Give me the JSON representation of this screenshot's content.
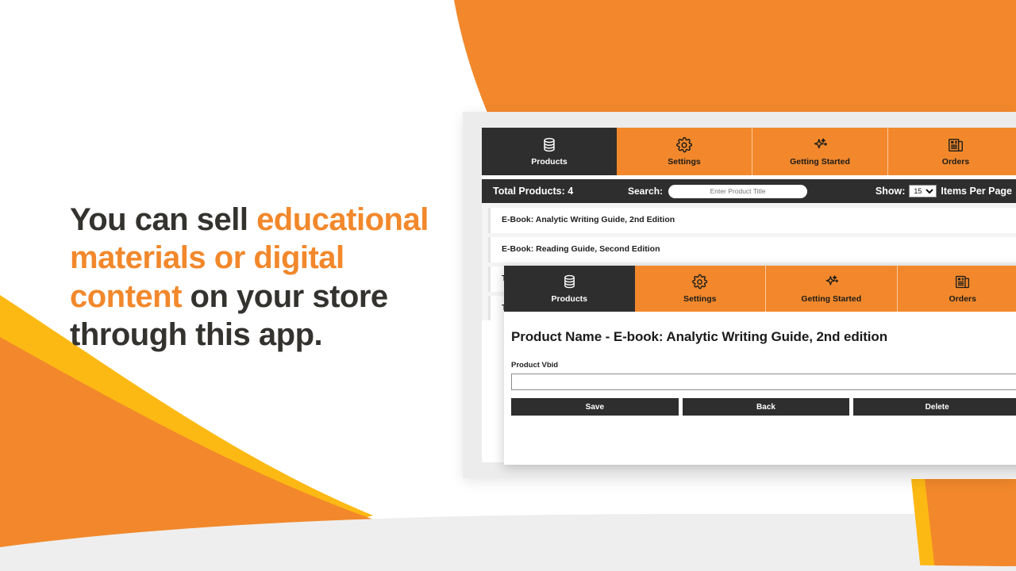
{
  "promo": {
    "segments": [
      {
        "text": "You can sell ",
        "highlight": false
      },
      {
        "text": "educational materials or digital content",
        "highlight": true
      },
      {
        "text": " on your store through this app.",
        "highlight": false
      }
    ],
    "plain": "You can sell educational materials or digital content on your store through this app."
  },
  "colors": {
    "orange": "#f2882b",
    "yellow": "#fdb913",
    "dark": "#2e2e2e",
    "frame_gray": "#ececec",
    "page_bg": "#f4f4f4"
  },
  "app": {
    "nav": [
      {
        "label": "Products",
        "icon": "database-icon",
        "active": true
      },
      {
        "label": "Settings",
        "icon": "gear-icon",
        "active": false
      },
      {
        "label": "Getting Started",
        "icon": "sparkles-icon",
        "active": false
      },
      {
        "label": "Orders",
        "icon": "newspaper-icon",
        "active": false
      }
    ],
    "toolbar": {
      "total_label": "Total Products: 4",
      "search_label": "Search:",
      "search_value": "",
      "search_placeholder": "Enter Product Title",
      "show_label": "Show:",
      "per_page_selected": "15",
      "per_page_options": [
        "15"
      ],
      "items_per_page_label": "Items Per Page"
    },
    "products": [
      {
        "title": "E-Book: Analytic Writing Guide, 2nd Edition"
      },
      {
        "title": "E-Book: Reading Guide, Second Edition"
      },
      {
        "title": "Test Product One"
      },
      {
        "title": "Test Product Two"
      }
    ]
  },
  "modal": {
    "nav": [
      {
        "label": "Products",
        "icon": "database-icon",
        "active": true
      },
      {
        "label": "Settings",
        "icon": "gear-icon",
        "active": false
      },
      {
        "label": "Getting Started",
        "icon": "sparkles-icon",
        "active": false
      },
      {
        "label": "Orders",
        "icon": "newspaper-icon",
        "active": false
      }
    ],
    "title": "Product Name - E-book: Analytic Writing Guide, 2nd edition",
    "field_label": "Product Vbid",
    "field_value": "",
    "buttons": [
      {
        "label": "Save",
        "name": "save-button"
      },
      {
        "label": "Back",
        "name": "back-button"
      },
      {
        "label": "Delete",
        "name": "delete-button"
      }
    ]
  }
}
